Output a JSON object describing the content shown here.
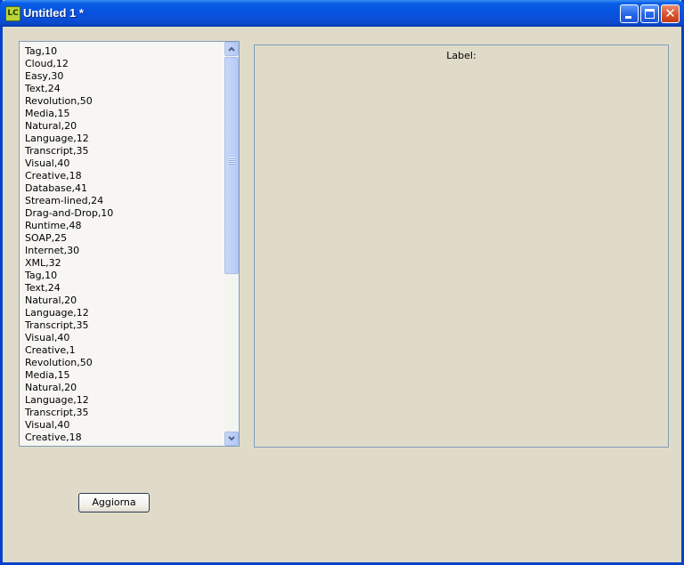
{
  "window": {
    "title": "Untitled 1 *",
    "icon": "lc-app-icon",
    "icon_text": "LC"
  },
  "list": {
    "items": [
      "Tag,10",
      "Cloud,12",
      "Easy,30",
      "Text,24",
      "Revolution,50",
      "Media,15",
      "Natural,20",
      "Language,12",
      "Transcript,35",
      "Visual,40",
      "Creative,18",
      "Database,41",
      "Stream-lined,24",
      "Drag-and-Drop,10",
      "Runtime,48",
      "SOAP,25",
      "Internet,30",
      "XML,32",
      "Tag,10",
      "Text,24",
      "Natural,20",
      "Language,12",
      "Transcript,35",
      "Visual,40",
      "Creative,1",
      "Revolution,50",
      "Media,15",
      "Natural,20",
      "Language,12",
      "Transcript,35",
      "Visual,40",
      "Creative,18"
    ]
  },
  "panel": {
    "label": "Label:"
  },
  "button": {
    "label": "Aggiorna"
  },
  "colors": {
    "window_bg": "#e0dbc9",
    "titlebar": "#0a4fd8",
    "close_button": "#d8532c"
  }
}
